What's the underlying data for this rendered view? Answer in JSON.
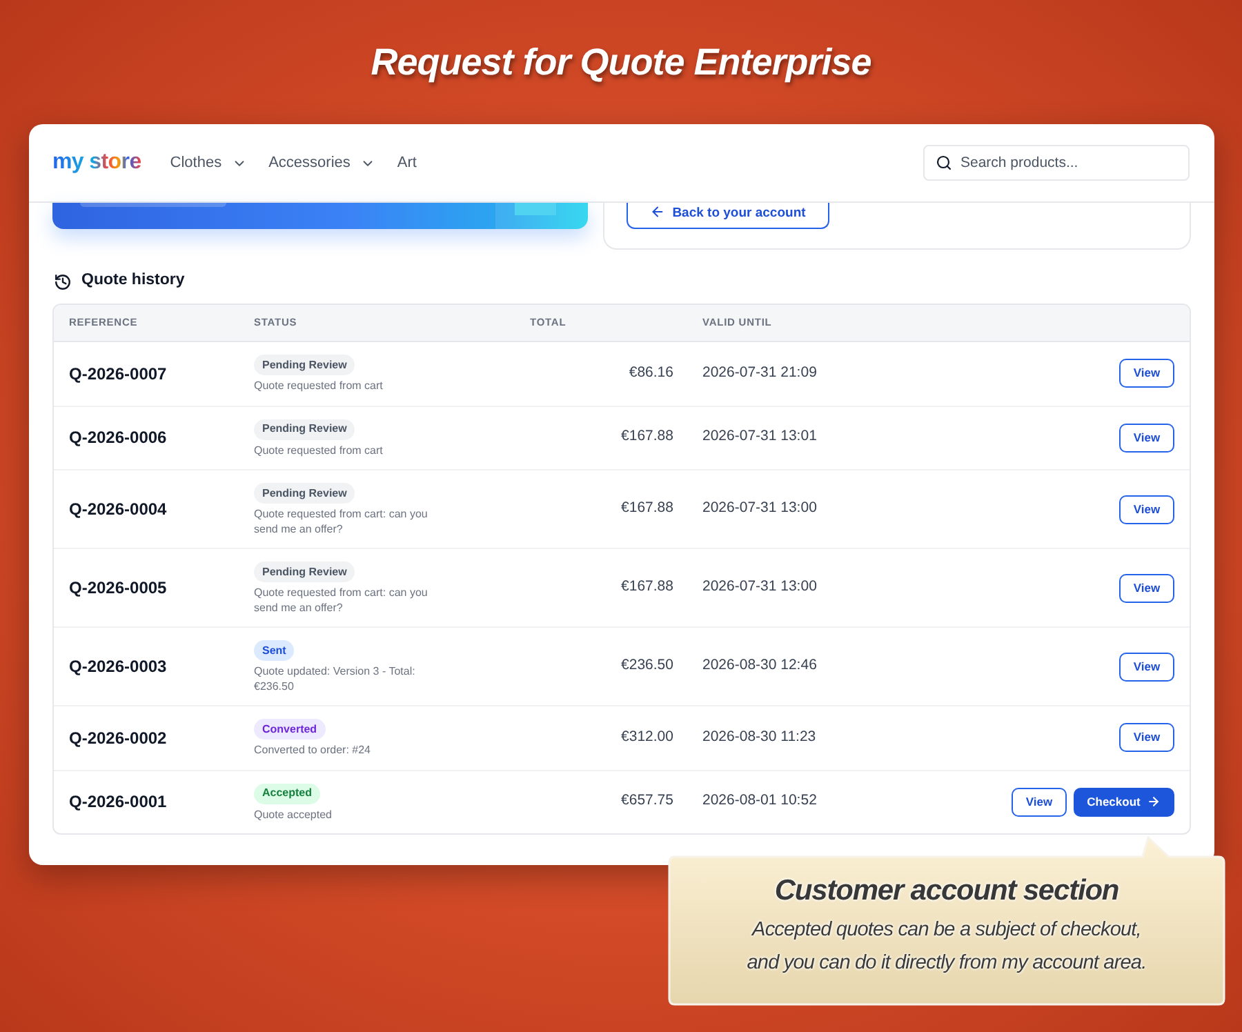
{
  "title": "Request for Quote Enterprise",
  "header": {
    "logo": "my store",
    "nav": [
      {
        "label": "Clothes",
        "has_menu": true
      },
      {
        "label": "Accessories",
        "has_menu": true
      },
      {
        "label": "Art",
        "has_menu": false
      }
    ],
    "search": {
      "placeholder": "Search products..."
    }
  },
  "account_panel": {
    "back_button": "Back to your account"
  },
  "quote_history": {
    "heading": "Quote history",
    "columns": [
      "REFERENCE",
      "STATUS",
      "TOTAL",
      "VALID UNTIL"
    ],
    "rows": [
      {
        "reference": "Q-2026-0007",
        "status": {
          "label": "Pending Review",
          "kind": "pending"
        },
        "note": "Quote requested from cart",
        "total": "€86.16",
        "valid_until": "2026-07-31 21:09",
        "actions": [
          {
            "label": "View",
            "kind": "outline"
          }
        ]
      },
      {
        "reference": "Q-2026-0006",
        "status": {
          "label": "Pending Review",
          "kind": "pending"
        },
        "note": "Quote requested from cart",
        "total": "€167.88",
        "valid_until": "2026-07-31 13:01",
        "actions": [
          {
            "label": "View",
            "kind": "outline"
          }
        ]
      },
      {
        "reference": "Q-2026-0004",
        "status": {
          "label": "Pending Review",
          "kind": "pending"
        },
        "note": "Quote requested from cart: can you send me an offer?",
        "total": "€167.88",
        "valid_until": "2026-07-31 13:00",
        "actions": [
          {
            "label": "View",
            "kind": "outline"
          }
        ]
      },
      {
        "reference": "Q-2026-0005",
        "status": {
          "label": "Pending Review",
          "kind": "pending"
        },
        "note": "Quote requested from cart: can you send me an offer?",
        "total": "€167.88",
        "valid_until": "2026-07-31 13:00",
        "actions": [
          {
            "label": "View",
            "kind": "outline"
          }
        ]
      },
      {
        "reference": "Q-2026-0003",
        "status": {
          "label": "Sent",
          "kind": "sent"
        },
        "note": "Quote updated: Version 3 - Total: €236.50",
        "total": "€236.50",
        "valid_until": "2026-08-30 12:46",
        "actions": [
          {
            "label": "View",
            "kind": "outline"
          }
        ]
      },
      {
        "reference": "Q-2026-0002",
        "status": {
          "label": "Converted",
          "kind": "converted"
        },
        "note": "Converted to order: #24",
        "total": "€312.00",
        "valid_until": "2026-08-30 11:23",
        "actions": [
          {
            "label": "View",
            "kind": "outline"
          }
        ]
      },
      {
        "reference": "Q-2026-0001",
        "status": {
          "label": "Accepted",
          "kind": "accepted"
        },
        "note": "Quote accepted",
        "total": "€657.75",
        "valid_until": "2026-08-01 10:52",
        "actions": [
          {
            "label": "View",
            "kind": "outline"
          },
          {
            "label": "Checkout",
            "kind": "primary"
          }
        ]
      }
    ]
  },
  "callout": {
    "title": "Customer account section",
    "body_lines": [
      "Accepted quotes can be a subject of checkout,",
      "and you can do it directly from my account area."
    ]
  }
}
